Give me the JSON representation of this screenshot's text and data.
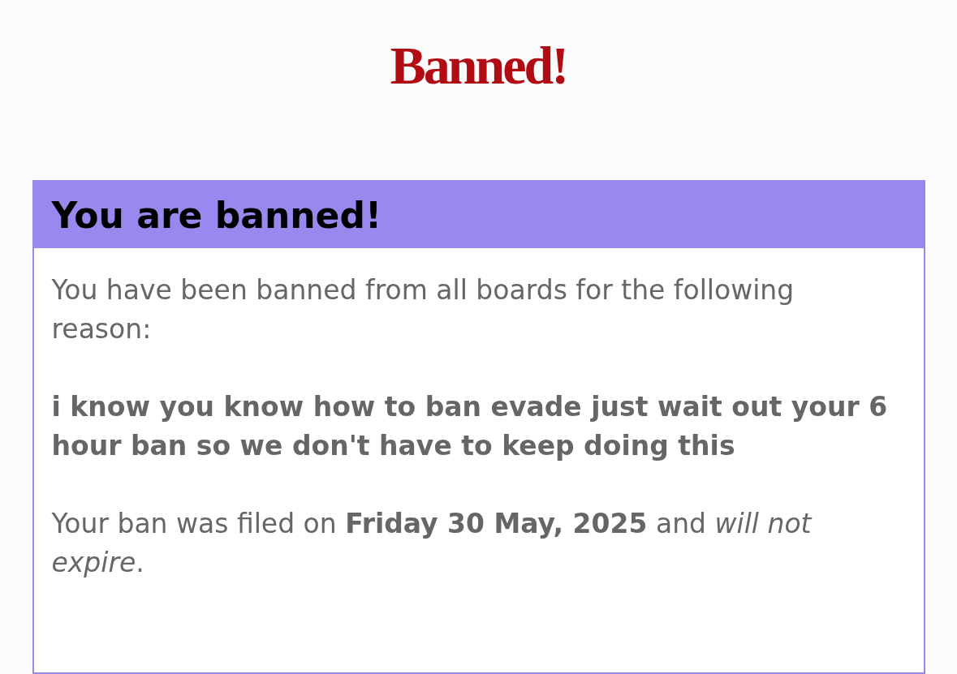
{
  "title": "Banned!",
  "panel": {
    "heading": "You are banned!",
    "paragraphs": [
      {
        "kind": "plain",
        "text": "You have been banned from all boards for the following reason:"
      },
      {
        "kind": "reason",
        "text": "i know you know how to ban evade just wait out your 6 hour ban so we don't have to keep doing this"
      },
      {
        "kind": "plain",
        "text": "Your ban was filed on **Friday 30 May, 2025** and *will not expire*."
      }
    ]
  }
}
